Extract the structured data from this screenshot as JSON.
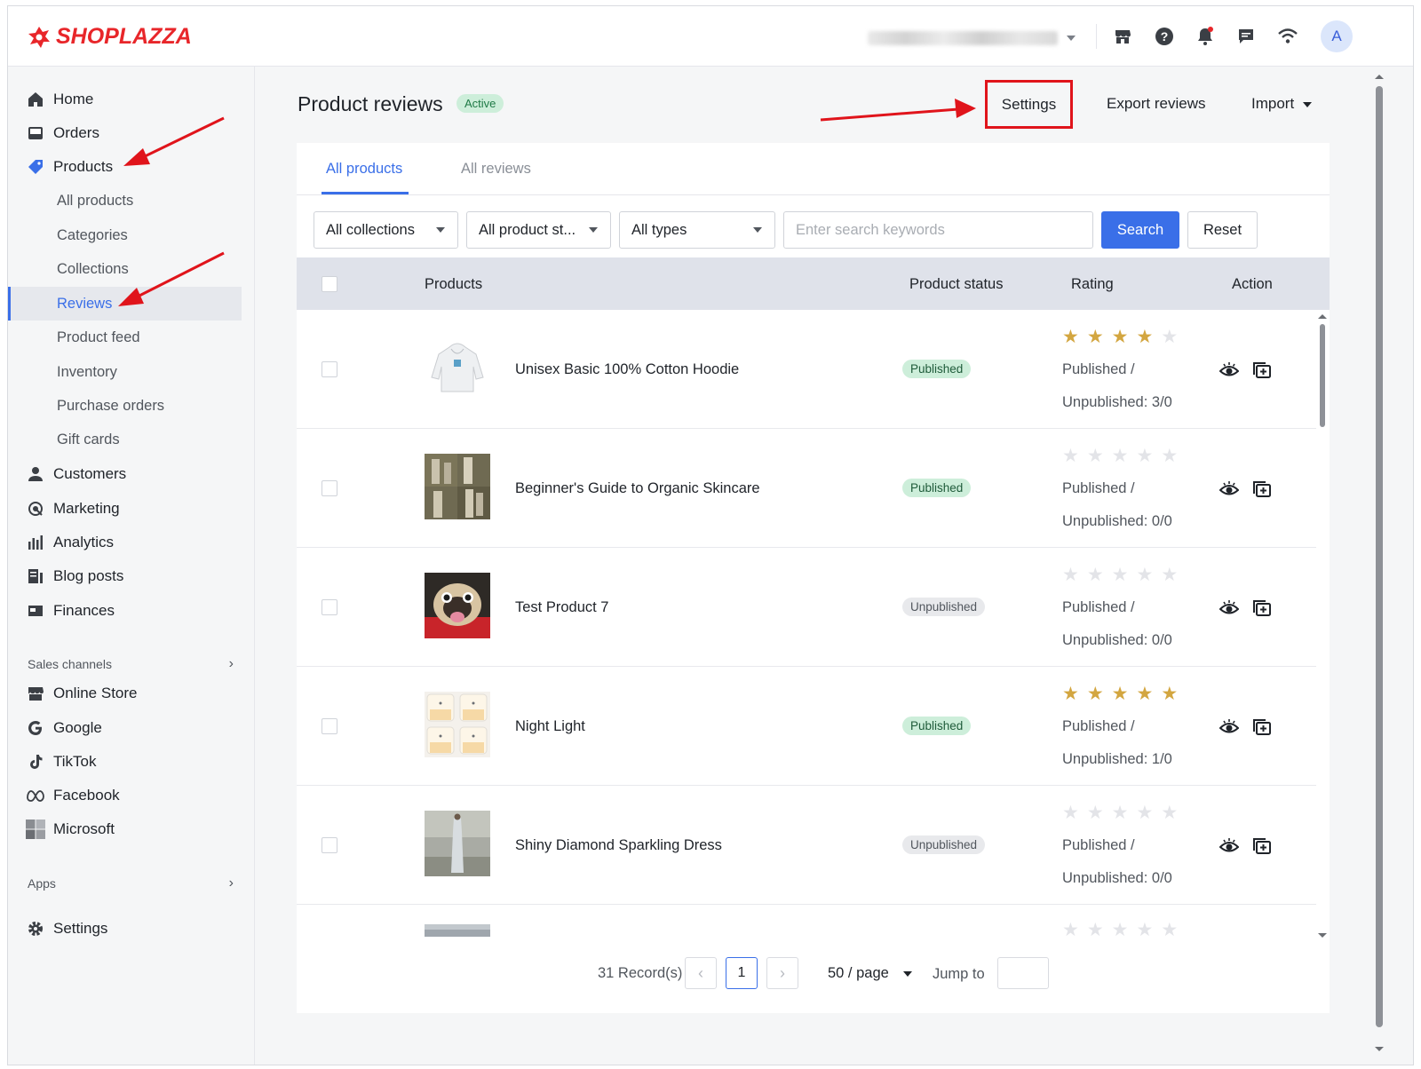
{
  "brand": {
    "name": "SHOPLAZZA",
    "color": "#e8262a"
  },
  "topbar": {
    "icons": [
      "store-icon",
      "help-icon",
      "bell-icon",
      "chat-icon",
      "wifi-icon"
    ],
    "avatar_initial": "A"
  },
  "sidebar": {
    "items": [
      {
        "label": "Home",
        "icon": "home-icon"
      },
      {
        "label": "Orders",
        "icon": "orders-icon"
      },
      {
        "label": "Products",
        "icon": "tag-icon"
      }
    ],
    "product_subitems": [
      "All products",
      "Categories",
      "Collections",
      "Reviews",
      "Product feed",
      "Inventory",
      "Purchase orders",
      "Gift cards"
    ],
    "active_subitem": "Reviews",
    "more_items": [
      {
        "label": "Customers",
        "icon": "user-icon"
      },
      {
        "label": "Marketing",
        "icon": "marketing-icon"
      },
      {
        "label": "Analytics",
        "icon": "analytics-icon"
      },
      {
        "label": "Blog posts",
        "icon": "blog-icon"
      },
      {
        "label": "Finances",
        "icon": "finance-icon"
      }
    ],
    "sales_channels_label": "Sales channels",
    "channels": [
      {
        "label": "Online Store",
        "icon": "store-icon"
      },
      {
        "label": "Google",
        "icon": "google-icon"
      },
      {
        "label": "TikTok",
        "icon": "tiktok-icon"
      },
      {
        "label": "Facebook",
        "icon": "meta-icon"
      },
      {
        "label": "Microsoft",
        "icon": "microsoft-icon"
      }
    ],
    "apps_label": "Apps",
    "settings_label": "Settings"
  },
  "header": {
    "title": "Product reviews",
    "status": "Active",
    "settings_label": "Settings",
    "export_label": "Export reviews",
    "import_label": "Import"
  },
  "tabs": [
    "All products",
    "All reviews"
  ],
  "filters": {
    "collections": "All collections",
    "status": "All product st...",
    "types": "All types",
    "search_placeholder": "Enter search keywords",
    "search_label": "Search",
    "reset_label": "Reset"
  },
  "table": {
    "columns": [
      "Products",
      "Product status",
      "Rating",
      "Action"
    ],
    "rows": [
      {
        "name": "Unisex Basic 100% Cotton Hoodie",
        "status": "Published",
        "stars": 4,
        "published_label": "Published /",
        "unpublished_label": "Unpublished: 3/0"
      },
      {
        "name": "Beginner's Guide to Organic Skincare",
        "status": "Published",
        "stars": 0,
        "published_label": "Published /",
        "unpublished_label": "Unpublished: 0/0"
      },
      {
        "name": "Test Product 7",
        "status": "Unpublished",
        "stars": 0,
        "published_label": "Published /",
        "unpublished_label": "Unpublished: 0/0"
      },
      {
        "name": "Night Light",
        "status": "Published",
        "stars": 5,
        "published_label": "Published /",
        "unpublished_label": "Unpublished: 1/0"
      },
      {
        "name": "Shiny Diamond Sparkling Dress",
        "status": "Unpublished",
        "stars": 0,
        "published_label": "Published /",
        "unpublished_label": "Unpublished: 0/0"
      }
    ],
    "action_icons": [
      "eye-icon",
      "add-review-icon"
    ]
  },
  "pagination": {
    "records": "31 Record(s)",
    "current_page": "1",
    "page_size": "50 / page",
    "jump_label": "Jump to"
  },
  "colors": {
    "accent": "#3a6fe8",
    "annotation_red": "#e0141b",
    "star": "#d3a640"
  }
}
